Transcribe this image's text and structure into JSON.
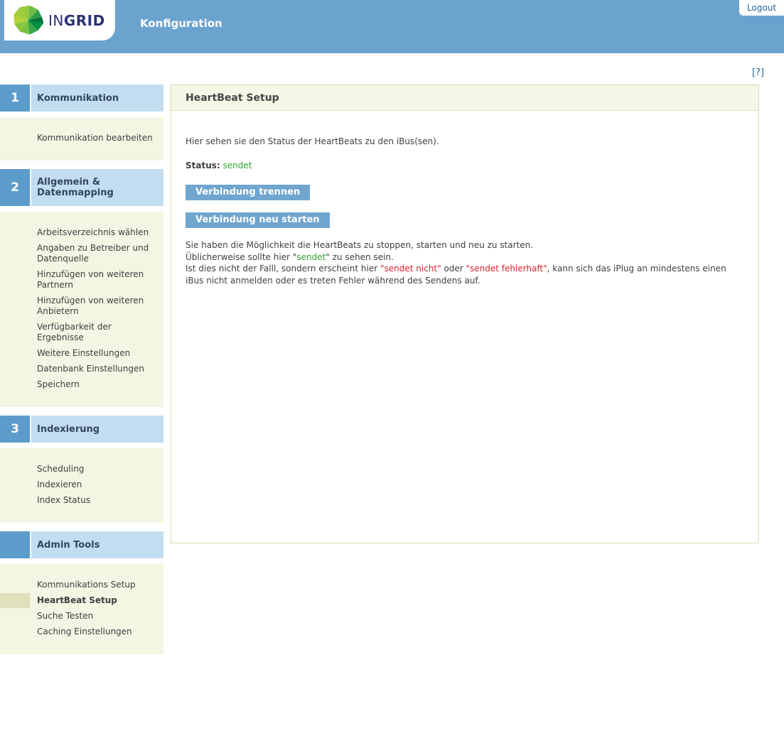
{
  "header": {
    "logo": {
      "text_light": "IN",
      "text_bold": "GRID"
    },
    "app_title": "Konfiguration",
    "logout_label": "Logout"
  },
  "help": {
    "label": "[?]"
  },
  "sidebar": {
    "sections": [
      {
        "number": "1",
        "title": "Kommunikation",
        "items": [
          {
            "label": "Kommunikation bearbeiten",
            "active": false
          }
        ]
      },
      {
        "number": "2",
        "title": "Allgemein & Datenmapping",
        "items": [
          {
            "label": "Arbeitsverzeichnis wählen",
            "active": false
          },
          {
            "label": "Angaben zu Betreiber und Datenquelle",
            "active": false
          },
          {
            "label": "Hinzufügen von weiteren Partnern",
            "active": false
          },
          {
            "label": "Hinzufügen von weiteren Anbietern",
            "active": false
          },
          {
            "label": "Verfügbarkeit der Ergebnisse",
            "active": false
          },
          {
            "label": "Weitere Einstellungen",
            "active": false
          },
          {
            "label": "Datenbank Einstellungen",
            "active": false
          },
          {
            "label": "Speichern",
            "active": false
          }
        ]
      },
      {
        "number": "3",
        "title": "Indexierung",
        "items": [
          {
            "label": "Scheduling",
            "active": false
          },
          {
            "label": "Indexieren",
            "active": false
          },
          {
            "label": "Index Status",
            "active": false
          }
        ]
      },
      {
        "number": "",
        "title": "Admin Tools",
        "items": [
          {
            "label": "Kommunikations Setup",
            "active": false
          },
          {
            "label": "HeartBeat Setup",
            "active": true
          },
          {
            "label": "Suche Testen",
            "active": false
          },
          {
            "label": "Caching Einstellungen",
            "active": false
          }
        ]
      }
    ]
  },
  "main": {
    "title": "HeartBeat Setup",
    "intro": "Hier sehen sie den Status der HeartBeats zu den iBus(sen).",
    "status": {
      "label": "Status:",
      "value": "sendet"
    },
    "buttons": {
      "disconnect": "Verbindung trennen",
      "restart": "Verbindung neu starten"
    },
    "description": {
      "line1": "Sie haben die Möglichkeit die HeartBeats zu stoppen, starten und neu zu starten.",
      "line2_before": "Üblicherweise sollte hier \"",
      "line2_ok": "sendet",
      "line2_after": "\" zu sehen sein.",
      "line3_before": "Ist dies nicht der Falll, sondern erscheint hier ",
      "line3_err1": "\"sendet nicht\"",
      "line3_between": " oder ",
      "line3_err2": "\"sendet fehlerhaft\"",
      "line3_after": ", kann sich das iPlug an mindestens einen iBus nicht anmelden oder es treten Fehler während des Sendens auf."
    }
  },
  "colors": {
    "header_blue": "#6ba3cf",
    "number_box_blue": "#5c9ccb",
    "section_title_blue": "#c3ddf0",
    "panel_beige": "#f4f5e3",
    "active_highlight": "#dfe0bc",
    "content_border": "#d9dbb0",
    "content_header_bg": "#f6f7e7",
    "button_blue": "#6fa5ce",
    "status_green": "#2ea42e",
    "error_red": "#d9232d",
    "link_blue": "#2e66a0",
    "logo_navy": "#2b3172"
  }
}
